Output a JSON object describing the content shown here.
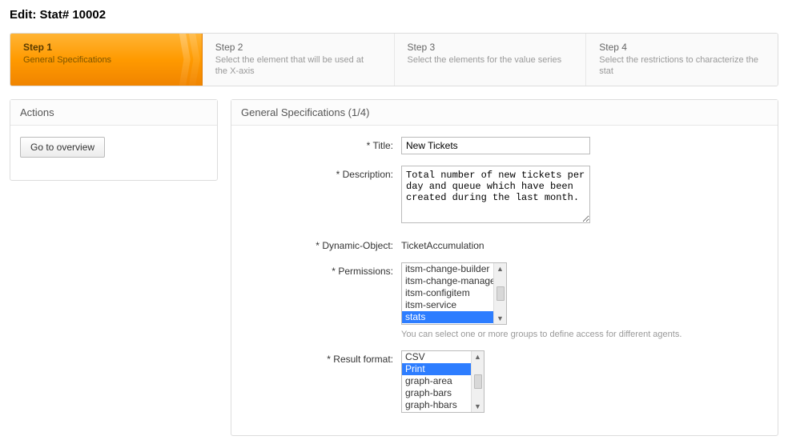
{
  "page_title": "Edit: Stat# 10002",
  "wizard": {
    "steps": [
      {
        "title": "Step 1",
        "desc": "General Specifications"
      },
      {
        "title": "Step 2",
        "desc": "Select the element that will be used at the X-axis"
      },
      {
        "title": "Step 3",
        "desc": "Select the elements for the value series"
      },
      {
        "title": "Step 4",
        "desc": "Select the restrictions to characterize the stat"
      }
    ]
  },
  "sidebar": {
    "header": "Actions",
    "overview_btn": "Go to overview"
  },
  "form": {
    "header": "General Specifications (1/4)",
    "labels": {
      "title": "Title:",
      "description": "Description:",
      "dynamic_object": "Dynamic-Object:",
      "permissions": "Permissions:",
      "result_format": "Result format:"
    },
    "title_value": "New Tickets",
    "description_value": "Total number of new tickets per day and queue which have been created during the last month.",
    "dynamic_object_value": "TicketAccumulation",
    "permissions_options": [
      "itsm-change-builder",
      "itsm-change-manager",
      "itsm-configitem",
      "itsm-service",
      "stats"
    ],
    "permissions_selected": "stats",
    "permissions_hint": "You can select one or more groups to define access for different agents.",
    "result_format_options": [
      "CSV",
      "Print",
      "graph-area",
      "graph-bars",
      "graph-hbars"
    ],
    "result_format_selected": "Print"
  }
}
